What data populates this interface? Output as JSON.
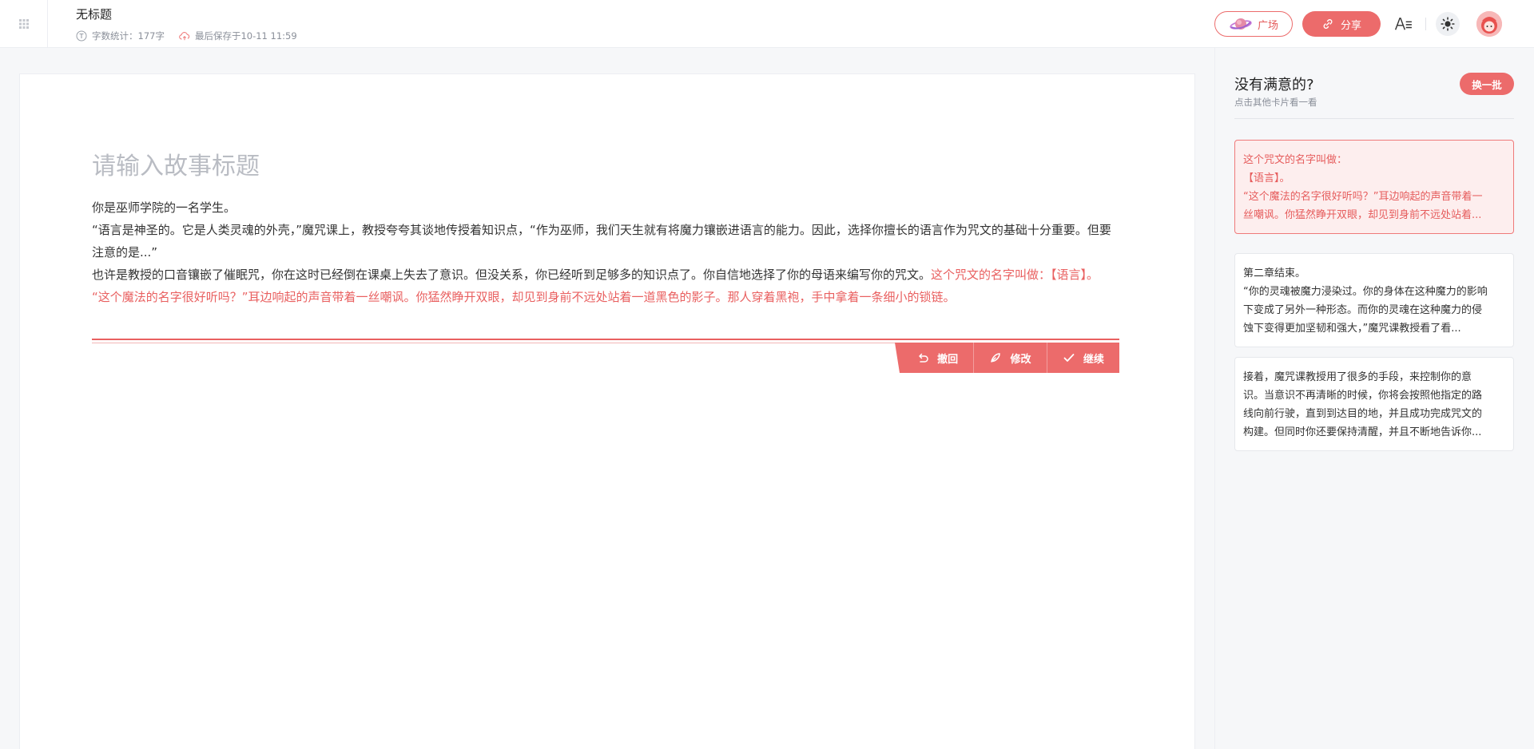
{
  "header": {
    "doc_title": "无标题",
    "word_count": "字数统计：177字",
    "last_saved": "最后保存于10-11 11:59",
    "plaza_label": "广场",
    "share_label": "分享",
    "font_button": "A☰"
  },
  "editor": {
    "title_placeholder": "请输入故事标题",
    "paragraphs": [
      "你是巫师学院的一名学生。",
      "“语言是神圣的。它是人类灵魂的外壳，”魔咒课上，教授夸夸其谈地传授着知识点，“作为巫师，我们天生就有将魔力镶嵌进语言的能力。因此，选择你擅长的语言作为咒文的基础十分重要。但要注意的是...”",
      "也许是教授的口音镶嵌了催眠咒，你在这时已经倒在课桌上失去了意识。但没关系，你已经听到足够多的知识点了。你自信地选择了你的母语来编写你的咒文。"
    ],
    "ai_text_1": "这个咒文的名字叫做：【语言】。",
    "ai_text_2": "“这个魔法的名字很好听吗？”耳边响起的声音带着一丝嘲讽。你猛然睁开双眼，却见到身前不远处站着一道黑色的影子。那人穿着黑袍，手中拿着一条细小的锁链。",
    "actions": {
      "undo": "撤回",
      "edit": "修改",
      "continue": "继续"
    }
  },
  "sidebar": {
    "title": "没有满意的?",
    "subtitle": "点击其他卡片看一看",
    "refresh_label": "换一批",
    "cards": [
      {
        "lines": [
          "这个咒文的名字叫做：",
          "【语言】。",
          "“这个魔法的名字很好听吗？”耳边响起的声音带着一",
          "丝嘲讽。你猛然睁开双眼，却见到身前不远处站着..."
        ]
      },
      {
        "lines": [
          "第二章结束。",
          "“你的灵魂被魔力浸染过。你的身体在这种魔力的影响",
          "下变成了另外一种形态。而你的灵魂在这种魔力的侵",
          "蚀下变得更加坚韧和强大，”魔咒课教授看了看..."
        ]
      },
      {
        "lines": [
          "接着，魔咒课教授用了很多的手段，来控制你的意",
          "识。当意识不再清晰的时候，你将会按照他指定的路",
          "线向前行驶，直到到达目的地，并且成功完成咒文的",
          "构建。但同时你还要保持清醒，并且不断地告诉你..."
        ]
      }
    ]
  },
  "colors": {
    "accent": "#ec6b6b",
    "accent_text": "#e96060",
    "selected_card_bg": "#fdeeee"
  }
}
